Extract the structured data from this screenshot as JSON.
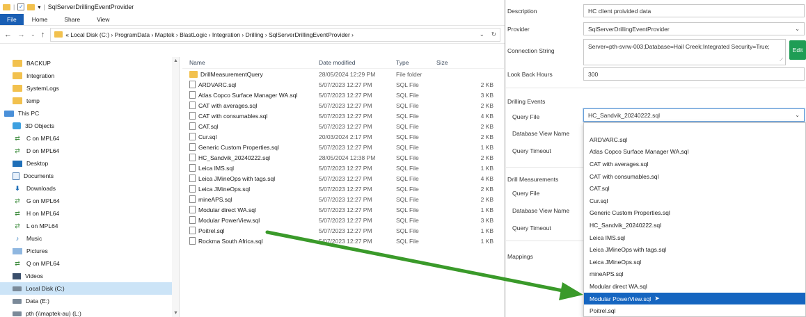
{
  "explorer": {
    "title": "SqlServerDrillingEventProvider",
    "ribbon_tabs": [
      "File",
      "Home",
      "Share",
      "View"
    ],
    "path": "«  Local Disk (C:)  ›  ProgramData  ›  Maptek  ›  BlastLogic  ›  Integration  ›  Drilling  ›  SqlServerDrillingEventProvider  ›",
    "nav_items": [
      {
        "label": "BACKUP",
        "icon": "folder-icon"
      },
      {
        "label": "Integration",
        "icon": "folder-icon"
      },
      {
        "label": "SystemLogs",
        "icon": "folder-icon"
      },
      {
        "label": "temp",
        "icon": "folder-icon"
      },
      {
        "label": "This PC",
        "icon": "computer-icon"
      },
      {
        "label": "3D Objects",
        "icon": "cube-icon"
      },
      {
        "label": "C on MPL64",
        "icon": "network-drive-icon"
      },
      {
        "label": "D on MPL64",
        "icon": "network-drive-icon"
      },
      {
        "label": "Desktop",
        "icon": "desktop-icon"
      },
      {
        "label": "Documents",
        "icon": "documents-icon"
      },
      {
        "label": "Downloads",
        "icon": "download-icon"
      },
      {
        "label": "G on MPL64",
        "icon": "network-drive-icon"
      },
      {
        "label": "H on MPL64",
        "icon": "network-drive-icon"
      },
      {
        "label": "L on MPL64",
        "icon": "network-drive-icon"
      },
      {
        "label": "Music",
        "icon": "music-icon"
      },
      {
        "label": "Pictures",
        "icon": "pictures-icon"
      },
      {
        "label": "Q on MPL64",
        "icon": "network-drive-icon"
      },
      {
        "label": "Videos",
        "icon": "videos-icon"
      },
      {
        "label": "Local Disk (C:)",
        "icon": "disk-icon"
      },
      {
        "label": "Data (E:)",
        "icon": "disk-icon"
      },
      {
        "label": "pth (\\\\maptek-au) (L:)",
        "icon": "network-disk-icon"
      }
    ],
    "columns": {
      "name": "Name",
      "date": "Date modified",
      "type": "Type",
      "size": "Size"
    },
    "files": [
      {
        "name": "DrillMeasurementQuery",
        "date": "28/05/2024 12:29 PM",
        "type": "File folder",
        "size": "",
        "kind": "folder"
      },
      {
        "name": "ARDVARC.sql",
        "date": "5/07/2023 12:27 PM",
        "type": "SQL File",
        "size": "2 KB",
        "kind": "file"
      },
      {
        "name": "Atlas Copco Surface Manager WA.sql",
        "date": "5/07/2023 12:27 PM",
        "type": "SQL File",
        "size": "3 KB",
        "kind": "file"
      },
      {
        "name": "CAT with averages.sql",
        "date": "5/07/2023 12:27 PM",
        "type": "SQL File",
        "size": "2 KB",
        "kind": "file"
      },
      {
        "name": "CAT with consumables.sql",
        "date": "5/07/2023 12:27 PM",
        "type": "SQL File",
        "size": "4 KB",
        "kind": "file"
      },
      {
        "name": "CAT.sql",
        "date": "5/07/2023 12:27 PM",
        "type": "SQL File",
        "size": "2 KB",
        "kind": "file"
      },
      {
        "name": "Cur.sql",
        "date": "20/03/2024 2:17 PM",
        "type": "SQL File",
        "size": "2 KB",
        "kind": "file"
      },
      {
        "name": "Generic Custom Properties.sql",
        "date": "5/07/2023 12:27 PM",
        "type": "SQL File",
        "size": "1 KB",
        "kind": "file"
      },
      {
        "name": "HC_Sandvik_20240222.sql",
        "date": "28/05/2024 12:38 PM",
        "type": "SQL File",
        "size": "2 KB",
        "kind": "file"
      },
      {
        "name": "Leica IMS.sql",
        "date": "5/07/2023 12:27 PM",
        "type": "SQL File",
        "size": "1 KB",
        "kind": "file"
      },
      {
        "name": "Leica JMineOps with tags.sql",
        "date": "5/07/2023 12:27 PM",
        "type": "SQL File",
        "size": "4 KB",
        "kind": "file"
      },
      {
        "name": "Leica JMineOps.sql",
        "date": "5/07/2023 12:27 PM",
        "type": "SQL File",
        "size": "2 KB",
        "kind": "file"
      },
      {
        "name": "mineAPS.sql",
        "date": "5/07/2023 12:27 PM",
        "type": "SQL File",
        "size": "2 KB",
        "kind": "file"
      },
      {
        "name": "Modular direct WA.sql",
        "date": "5/07/2023 12:27 PM",
        "type": "SQL File",
        "size": "1 KB",
        "kind": "file"
      },
      {
        "name": "Modular PowerView.sql",
        "date": "5/07/2023 12:27 PM",
        "type": "SQL File",
        "size": "3 KB",
        "kind": "file"
      },
      {
        "name": "Poitrel.sql",
        "date": "5/07/2023 12:27 PM",
        "type": "SQL File",
        "size": "1 KB",
        "kind": "file"
      },
      {
        "name": "Rockma South Africa.sql",
        "date": "5/07/2023 12:27 PM",
        "type": "SQL File",
        "size": "1 KB",
        "kind": "file"
      }
    ]
  },
  "settings": {
    "description_label": "Description",
    "description_value": "HC client proivided data",
    "provider_label": "Provider",
    "provider_value": "SqlServerDrillingEventProvider",
    "connection_label": "Connection String",
    "connection_value": "Server=pth-svrw-003;Database=Hail Creek;Integrated Security=True;",
    "edit_label": "Edit",
    "lookback_label": "Look Back Hours",
    "lookback_value": "300",
    "drilling_events_label": "Drilling Events",
    "query_file_label": "Query File",
    "query_file_value": "HC_Sandvik_20240222.sql",
    "db_view_label": "Database View Name",
    "query_timeout_label": "Query Timeout",
    "drill_measurements_label": "Drill Measurements",
    "dm_query_file_label": "Query File",
    "dm_db_view_label": "Database View Name",
    "dm_query_timeout_label": "Query Timeout",
    "mappings_label": "Mappings",
    "dropdown_options": [
      "ARDVARC.sql",
      "Atlas Copco Surface Manager WA.sql",
      "CAT with averages.sql",
      "CAT with consumables.sql",
      "CAT.sql",
      "Cur.sql",
      "Generic Custom Properties.sql",
      "HC_Sandvik_20240222.sql",
      "Leica IMS.sql",
      "Leica JMineOps with tags.sql",
      "Leica JMineOps.sql",
      "mineAPS.sql",
      "Modular direct WA.sql",
      "Modular PowerView.sql",
      "Poitrel.sql"
    ],
    "dropdown_selected_index": 13
  },
  "colors": {
    "accent": "#1565c0",
    "arrow": "#3a9a2a",
    "edit_button": "#1f9d55"
  }
}
